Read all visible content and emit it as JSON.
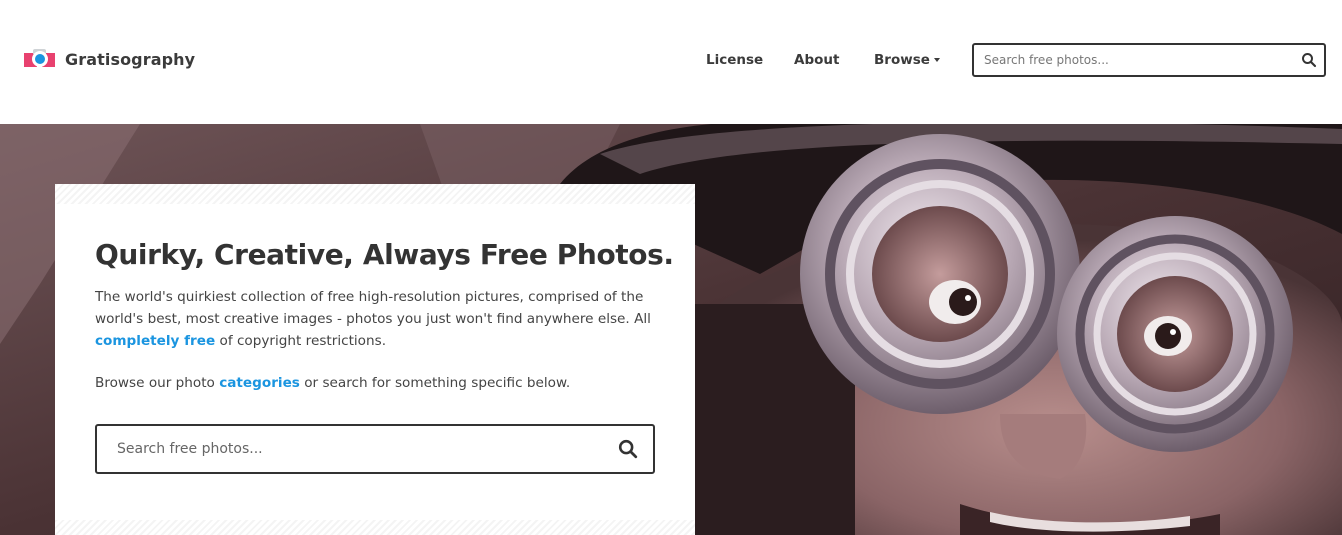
{
  "brand": {
    "name": "Gratisography",
    "logo_icon": "camera-icon",
    "accent": "#e8416f",
    "lens_color": "#1b95e0"
  },
  "nav": {
    "license": "License",
    "about": "About",
    "browse": "Browse"
  },
  "header_search": {
    "placeholder": "Search free photos..."
  },
  "hero": {
    "title": "Quirky, Creative, Always Free Photos.",
    "desc_before": "The world's quirkiest collection of free high-resolution pictures, comprised of the world's best, most creative images - photos you just won't find anywhere else. All ",
    "desc_link": "completely free",
    "desc_after": " of copyright restrictions.",
    "browse_before": "Browse our photo ",
    "browse_link": "categories",
    "browse_after": " or search for something specific below.",
    "search_placeholder": "Search free photos...",
    "link_color": "#1b95e0"
  }
}
